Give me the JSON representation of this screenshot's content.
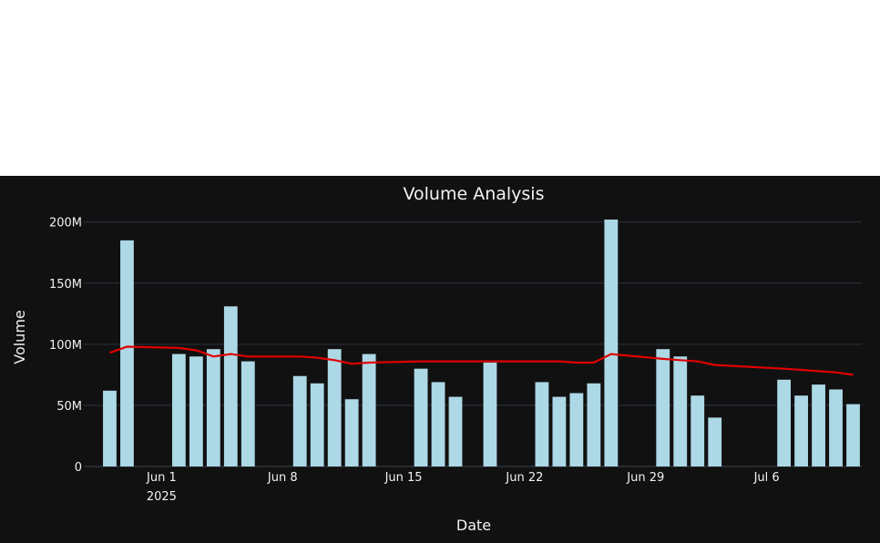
{
  "chart_data": {
    "type": "bar",
    "title": "Volume Analysis",
    "xlabel": "Date",
    "ylabel": "Volume",
    "ylim": [
      0,
      202000000
    ],
    "yticks": [
      {
        "value": 0,
        "label": "0"
      },
      {
        "value": 50000000,
        "label": "50M"
      },
      {
        "value": 100000000,
        "label": "100M"
      },
      {
        "value": 150000000,
        "label": "150M"
      },
      {
        "value": 200000000,
        "label": "200M"
      }
    ],
    "xrange": [
      "2025-05-28",
      "2025-07-11"
    ],
    "xticks": [
      {
        "date": "2025-06-01",
        "label": "Jun 1",
        "sublabel": "2025"
      },
      {
        "date": "2025-06-08",
        "label": "Jun 8"
      },
      {
        "date": "2025-06-15",
        "label": "Jun 15"
      },
      {
        "date": "2025-06-22",
        "label": "Jun 22"
      },
      {
        "date": "2025-06-29",
        "label": "Jun 29"
      },
      {
        "date": "2025-07-06",
        "label": "Jul 6"
      }
    ],
    "grid": true,
    "bar_color": "#add8e6",
    "line_color": "#e00000",
    "background": "#111111",
    "series": [
      {
        "type": "bar",
        "points": [
          {
            "date": "2025-05-29",
            "value": 62000000
          },
          {
            "date": "2025-05-30",
            "value": 185000000
          },
          {
            "date": "2025-06-02",
            "value": 92000000
          },
          {
            "date": "2025-06-03",
            "value": 90000000
          },
          {
            "date": "2025-06-04",
            "value": 96000000
          },
          {
            "date": "2025-06-05",
            "value": 131000000
          },
          {
            "date": "2025-06-06",
            "value": 86000000
          },
          {
            "date": "2025-06-09",
            "value": 74000000
          },
          {
            "date": "2025-06-10",
            "value": 68000000
          },
          {
            "date": "2025-06-11",
            "value": 96000000
          },
          {
            "date": "2025-06-12",
            "value": 55000000
          },
          {
            "date": "2025-06-13",
            "value": 92000000
          },
          {
            "date": "2025-06-16",
            "value": 80000000
          },
          {
            "date": "2025-06-17",
            "value": 69000000
          },
          {
            "date": "2025-06-18",
            "value": 57000000
          },
          {
            "date": "2025-06-20",
            "value": 85000000
          },
          {
            "date": "2025-06-23",
            "value": 69000000
          },
          {
            "date": "2025-06-24",
            "value": 57000000
          },
          {
            "date": "2025-06-25",
            "value": 60000000
          },
          {
            "date": "2025-06-26",
            "value": 68000000
          },
          {
            "date": "2025-06-27",
            "value": 202000000
          },
          {
            "date": "2025-06-30",
            "value": 96000000
          },
          {
            "date": "2025-07-01",
            "value": 90000000
          },
          {
            "date": "2025-07-02",
            "value": 58000000
          },
          {
            "date": "2025-07-03",
            "value": 40000000
          },
          {
            "date": "2025-07-07",
            "value": 71000000
          },
          {
            "date": "2025-07-08",
            "value": 58000000
          },
          {
            "date": "2025-07-09",
            "value": 67000000
          },
          {
            "date": "2025-07-10",
            "value": 63000000
          },
          {
            "date": "2025-07-11",
            "value": 51000000
          }
        ]
      },
      {
        "type": "line",
        "points": [
          {
            "date": "2025-05-29",
            "value": 93000000
          },
          {
            "date": "2025-05-30",
            "value": 98000000
          },
          {
            "date": "2025-06-02",
            "value": 97000000
          },
          {
            "date": "2025-06-03",
            "value": 95000000
          },
          {
            "date": "2025-06-04",
            "value": 90000000
          },
          {
            "date": "2025-06-05",
            "value": 92000000
          },
          {
            "date": "2025-06-06",
            "value": 90000000
          },
          {
            "date": "2025-06-09",
            "value": 90000000
          },
          {
            "date": "2025-06-10",
            "value": 89000000
          },
          {
            "date": "2025-06-11",
            "value": 87000000
          },
          {
            "date": "2025-06-12",
            "value": 84000000
          },
          {
            "date": "2025-06-13",
            "value": 85000000
          },
          {
            "date": "2025-06-16",
            "value": 86000000
          },
          {
            "date": "2025-06-17",
            "value": 86000000
          },
          {
            "date": "2025-06-18",
            "value": 86000000
          },
          {
            "date": "2025-06-20",
            "value": 86000000
          },
          {
            "date": "2025-06-23",
            "value": 86000000
          },
          {
            "date": "2025-06-24",
            "value": 86000000
          },
          {
            "date": "2025-06-25",
            "value": 85000000
          },
          {
            "date": "2025-06-26",
            "value": 85000000
          },
          {
            "date": "2025-06-27",
            "value": 92000000
          },
          {
            "date": "2025-06-30",
            "value": 88000000
          },
          {
            "date": "2025-07-01",
            "value": 87000000
          },
          {
            "date": "2025-07-02",
            "value": 86000000
          },
          {
            "date": "2025-07-03",
            "value": 83000000
          },
          {
            "date": "2025-07-07",
            "value": 80000000
          },
          {
            "date": "2025-07-08",
            "value": 79000000
          },
          {
            "date": "2025-07-09",
            "value": 78000000
          },
          {
            "date": "2025-07-10",
            "value": 77000000
          },
          {
            "date": "2025-07-11",
            "value": 75000000
          }
        ]
      }
    ]
  }
}
